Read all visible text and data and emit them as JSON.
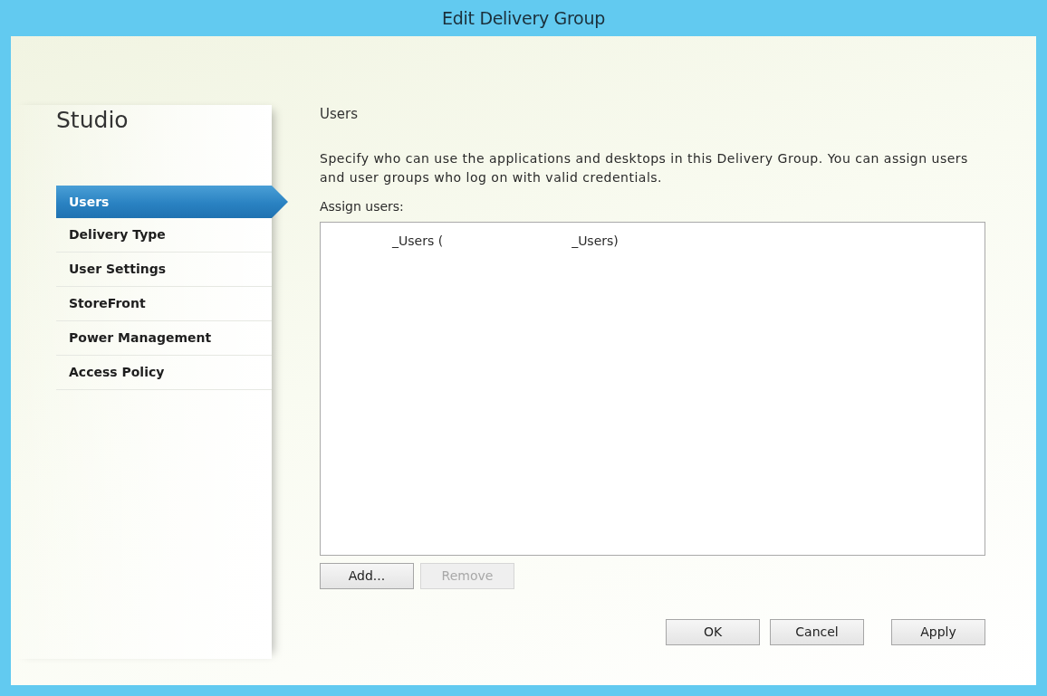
{
  "window": {
    "title": "Edit Delivery Group"
  },
  "sidebar": {
    "title": "Studio",
    "items": [
      {
        "label": "Users",
        "selected": true
      },
      {
        "label": "Delivery Type",
        "selected": false
      },
      {
        "label": "User Settings",
        "selected": false
      },
      {
        "label": "StoreFront",
        "selected": false
      },
      {
        "label": "Power Management",
        "selected": false
      },
      {
        "label": "Access Policy",
        "selected": false
      }
    ]
  },
  "page": {
    "heading": "Users",
    "description": "Specify who can use the applications and desktops in this Delivery Group. You can assign users and user groups who log on with valid credentials.",
    "assign_label": "Assign users:",
    "assigned_users": [
      {
        "parts": [
          "_Users (",
          "_Users)"
        ]
      }
    ],
    "list_buttons": [
      {
        "label": "Add...",
        "disabled": false
      },
      {
        "label": "Remove",
        "disabled": true
      }
    ]
  },
  "buttons": [
    {
      "label": "OK"
    },
    {
      "label": "Cancel"
    },
    {
      "label": "Apply"
    }
  ]
}
